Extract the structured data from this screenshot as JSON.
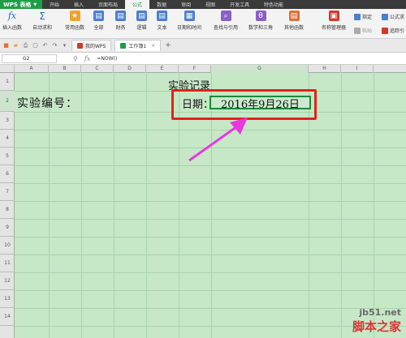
{
  "menubar": {
    "app_label": "WPS 表格",
    "items": [
      "开始",
      "插入",
      "页面布局",
      "公式",
      "数据",
      "审阅",
      "视图",
      "开发工具",
      "特色功能"
    ]
  },
  "ribbon": {
    "insert_fn": "插入函数",
    "autosum": "自动求和",
    "common_fn": "常用函数",
    "all": "全部",
    "finance": "财务",
    "logic": "逻辑",
    "text": "文本",
    "datetime": "日期和时间",
    "lookup": "查找与引用",
    "math": "数学和三角",
    "other": "其他函数",
    "name_mgr": "名称管理器",
    "specify": "指定",
    "paste": "粘贴",
    "formula": "公式求",
    "trace": "追踪引"
  },
  "tabbar": {
    "tab1": "我的WPS",
    "tab2": "工作簿1",
    "add": "+"
  },
  "formula_bar": {
    "name_box": "G2",
    "formula": "=NOW()"
  },
  "grid": {
    "columns": [
      "A",
      "B",
      "C",
      "D",
      "E",
      "F",
      "G",
      "H",
      "I"
    ],
    "rows": [
      "1",
      "2",
      "3",
      "4",
      "5",
      "6",
      "7",
      "8",
      "9",
      "10",
      "11",
      "12",
      "13",
      "14"
    ]
  },
  "cells": {
    "title": "实验记录",
    "label_id": "实验编号：",
    "label_date": "日期：",
    "date_value": "2016年9月26日"
  },
  "watermark": {
    "line1": "jb51.net",
    "line2": "脚本之家"
  },
  "colors": {
    "accent_green": "#1e9e48",
    "grid_bg": "#c6e8c7",
    "highlight_red": "#e0231c",
    "arrow_magenta": "#e838e0"
  }
}
